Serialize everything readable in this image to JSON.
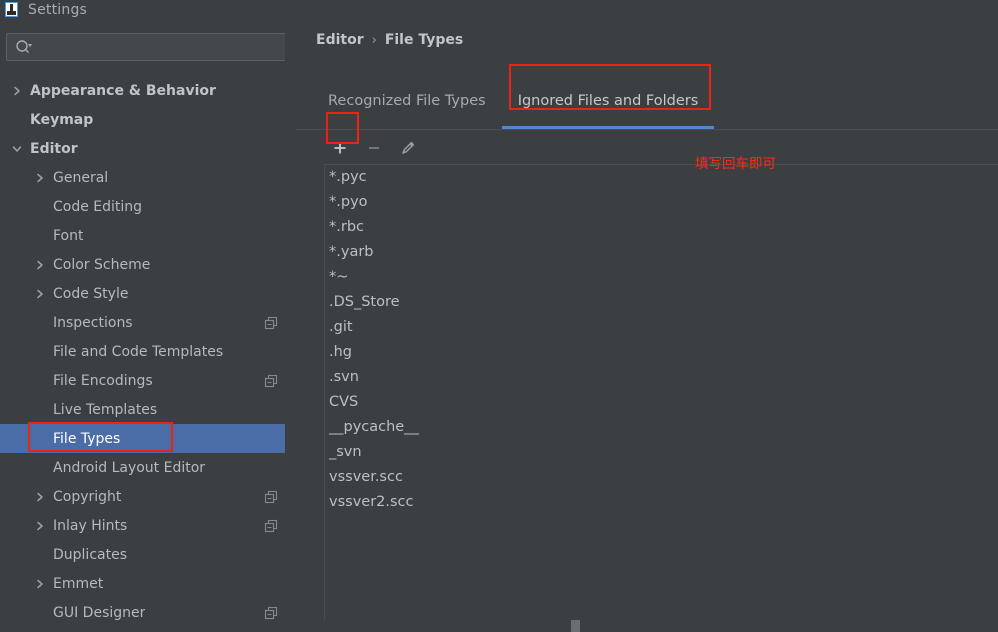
{
  "window": {
    "title": "Settings",
    "icon": "settings-window-icon"
  },
  "sidebar": {
    "search": {
      "placeholder": "",
      "value": "",
      "icon": "search-icon"
    },
    "items": [
      {
        "label": "Appearance & Behavior",
        "level": 0,
        "arrow": "collapsed",
        "badge": false,
        "selected": false
      },
      {
        "label": "Keymap",
        "level": 0,
        "arrow": "none",
        "badge": false,
        "selected": false
      },
      {
        "label": "Editor",
        "level": 0,
        "arrow": "expanded",
        "badge": false,
        "selected": false
      },
      {
        "label": "General",
        "level": 1,
        "arrow": "collapsed",
        "badge": false,
        "selected": false
      },
      {
        "label": "Code Editing",
        "level": 1,
        "arrow": "none",
        "badge": false,
        "selected": false
      },
      {
        "label": "Font",
        "level": 1,
        "arrow": "none",
        "badge": false,
        "selected": false
      },
      {
        "label": "Color Scheme",
        "level": 1,
        "arrow": "collapsed",
        "badge": false,
        "selected": false
      },
      {
        "label": "Code Style",
        "level": 1,
        "arrow": "collapsed",
        "badge": false,
        "selected": false
      },
      {
        "label": "Inspections",
        "level": 1,
        "arrow": "none",
        "badge": true,
        "selected": false
      },
      {
        "label": "File and Code Templates",
        "level": 1,
        "arrow": "none",
        "badge": false,
        "selected": false
      },
      {
        "label": "File Encodings",
        "level": 1,
        "arrow": "none",
        "badge": true,
        "selected": false
      },
      {
        "label": "Live Templates",
        "level": 1,
        "arrow": "none",
        "badge": false,
        "selected": false
      },
      {
        "label": "File Types",
        "level": 1,
        "arrow": "none",
        "badge": false,
        "selected": true
      },
      {
        "label": "Android Layout Editor",
        "level": 1,
        "arrow": "none",
        "badge": false,
        "selected": false
      },
      {
        "label": "Copyright",
        "level": 1,
        "arrow": "collapsed",
        "badge": true,
        "selected": false
      },
      {
        "label": "Inlay Hints",
        "level": 1,
        "arrow": "collapsed",
        "badge": true,
        "selected": false
      },
      {
        "label": "Duplicates",
        "level": 1,
        "arrow": "none",
        "badge": false,
        "selected": false
      },
      {
        "label": "Emmet",
        "level": 1,
        "arrow": "collapsed",
        "badge": false,
        "selected": false
      },
      {
        "label": "GUI Designer",
        "level": 1,
        "arrow": "none",
        "badge": true,
        "selected": false
      }
    ]
  },
  "main": {
    "breadcrumb": {
      "root": "Editor",
      "separator": "›",
      "leaf": "File Types"
    },
    "tabs": [
      {
        "label": "Recognized File Types",
        "active": false
      },
      {
        "label": "Ignored Files and Folders",
        "active": true
      }
    ],
    "toolbar": {
      "add_label": "+",
      "remove_label": "−",
      "add_icon": "plus-icon",
      "remove_icon": "minus-icon",
      "edit_icon": "pencil-icon"
    },
    "annotation": "填写回车即可",
    "ignored_list": [
      "*.pyc",
      "*.pyo",
      "*.rbc",
      "*.yarb",
      "*~",
      ".DS_Store",
      ".git",
      ".hg",
      ".svn",
      "CVS",
      "__pycache__",
      "_svn",
      "vssver.scc",
      "vssver2.scc"
    ]
  },
  "colors": {
    "background": "#3c3f41",
    "selection": "#4a6da7",
    "tab_underline": "#4f87d6",
    "annotation_red": "#ee2211",
    "text": "#bbbbbb"
  }
}
